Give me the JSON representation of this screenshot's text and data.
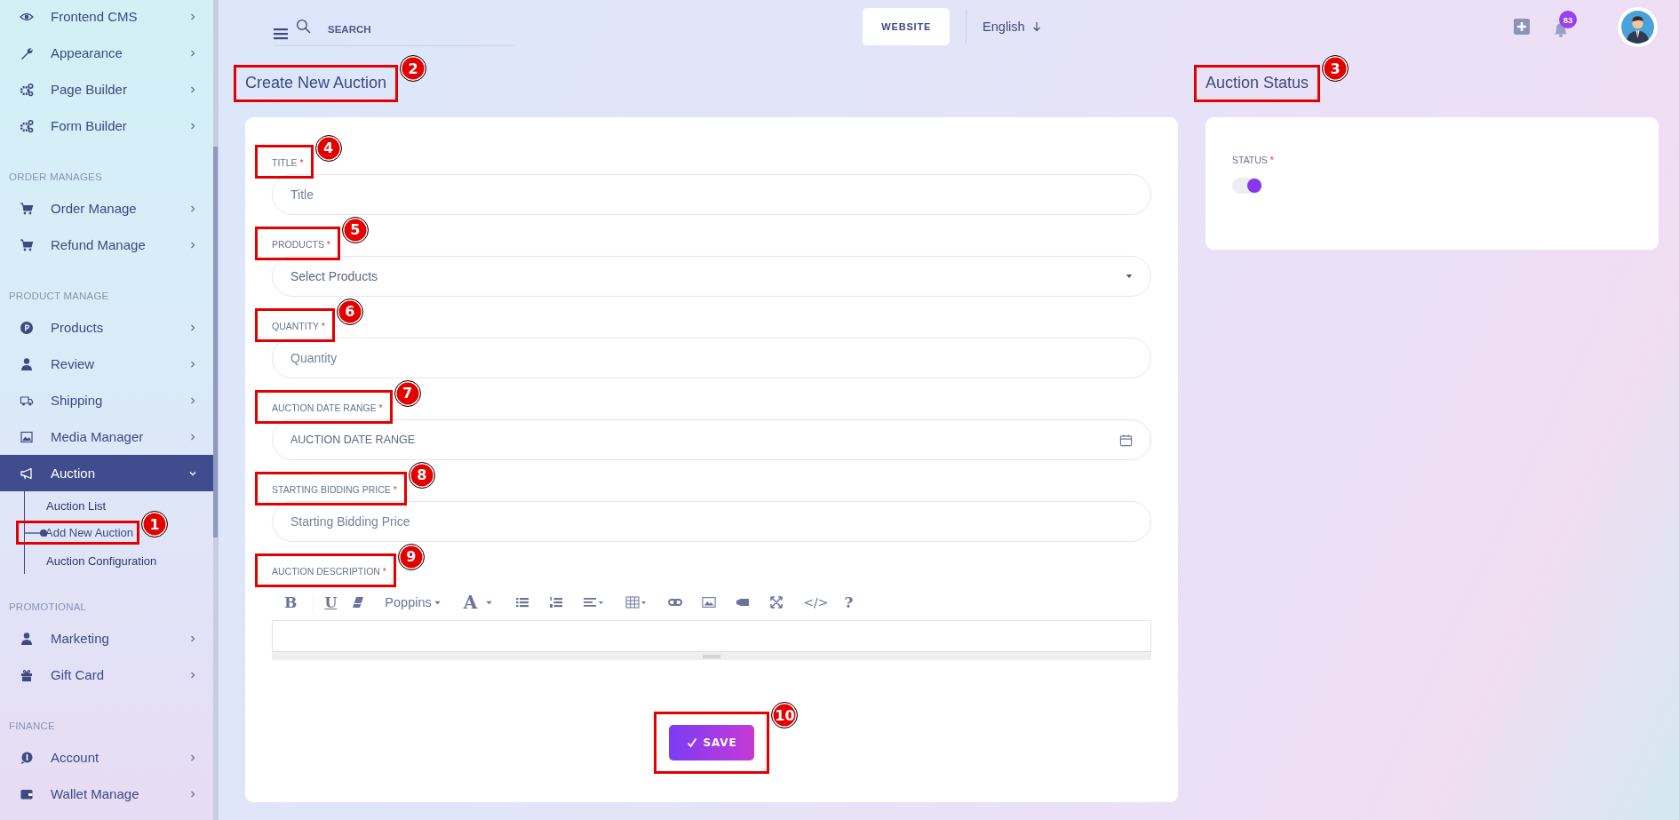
{
  "sidebar": {
    "groups": [
      {
        "items": [
          {
            "label": "Frontend CMS",
            "selected": false,
            "expanded": false
          },
          {
            "label": "Appearance",
            "selected": false,
            "expanded": false
          },
          {
            "label": "Page Builder",
            "selected": false,
            "expanded": false
          },
          {
            "label": "Form Builder",
            "selected": false,
            "expanded": false
          }
        ]
      },
      {
        "heading": "ORDER MANAGES",
        "items": [
          {
            "label": "Order Manage",
            "selected": false,
            "expanded": false
          },
          {
            "label": "Refund Manage",
            "selected": false,
            "expanded": false
          }
        ]
      },
      {
        "heading": "PRODUCT MANAGE",
        "items": [
          {
            "label": "Products",
            "selected": false,
            "expanded": false
          },
          {
            "label": "Review",
            "selected": false,
            "expanded": false
          },
          {
            "label": "Shipping",
            "selected": false,
            "expanded": false
          },
          {
            "label": "Media Manager",
            "selected": false,
            "expanded": false
          },
          {
            "label": "Auction",
            "selected": true,
            "expanded": true,
            "children": [
              {
                "label": "Auction List",
                "selected": false
              },
              {
                "label": "Add New Auction",
                "selected": true,
                "callout": "1"
              },
              {
                "label": "Auction Configuration",
                "selected": false
              }
            ]
          }
        ]
      },
      {
        "heading": "PROMOTIONAL",
        "items": [
          {
            "label": "Marketing",
            "selected": false,
            "expanded": false
          },
          {
            "label": "Gift Card",
            "selected": false,
            "expanded": false
          }
        ]
      },
      {
        "heading": "FINANCE",
        "items": [
          {
            "label": "Account",
            "selected": false,
            "expanded": false
          },
          {
            "label": "Wallet Manage",
            "selected": false,
            "expanded": false
          }
        ]
      }
    ]
  },
  "topbar": {
    "search": {
      "placeholder": "SEARCH"
    },
    "website_button": "WEBSITE",
    "language": "English",
    "notification_count": "83"
  },
  "form": {
    "title": "Create New Auction",
    "callout": "2",
    "fields": [
      {
        "kind": "text",
        "label": "TITLE",
        "required_mark": "*",
        "placeholder": "Title",
        "callout": "4"
      },
      {
        "kind": "select",
        "label": "PRODUCTS",
        "required_mark": "*",
        "placeholder": "Select Products",
        "callout": "5"
      },
      {
        "kind": "text",
        "label": "QUANTITY",
        "required_mark": "*",
        "placeholder": "Quantity",
        "callout": "6"
      },
      {
        "kind": "date",
        "label": "AUCTION DATE RANGE",
        "required_mark": "*",
        "placeholder": "AUCTION DATE RANGE",
        "callout": "7"
      },
      {
        "kind": "text",
        "label": "STARTING BIDDING PRICE",
        "required_mark": "*",
        "placeholder": "Starting Bidding Price",
        "callout": "8"
      },
      {
        "kind": "editor",
        "label": "AUCTION DESCRIPTION",
        "required_mark": "*",
        "callout": "9",
        "toolbar": [
          {
            "kind": "bold",
            "glyph": "B"
          },
          {
            "kind": "underline",
            "glyph": "U"
          },
          {
            "kind": "eraser"
          },
          {
            "kind": "font",
            "label": "Poppins"
          },
          {
            "kind": "color",
            "glyph": "A"
          },
          {
            "kind": "ul"
          },
          {
            "kind": "ol"
          },
          {
            "kind": "align"
          },
          {
            "kind": "table"
          },
          {
            "kind": "link"
          },
          {
            "kind": "image"
          },
          {
            "kind": "video"
          },
          {
            "kind": "fullscreen"
          },
          {
            "kind": "code",
            "glyph": "</>"
          },
          {
            "kind": "help",
            "glyph": "?"
          }
        ]
      }
    ],
    "save_button": {
      "label": "SAVE",
      "callout": "10"
    }
  },
  "status_panel": {
    "title": "Auction Status",
    "callout": "3",
    "label": "STATUS",
    "required_mark": "*",
    "on": true
  }
}
